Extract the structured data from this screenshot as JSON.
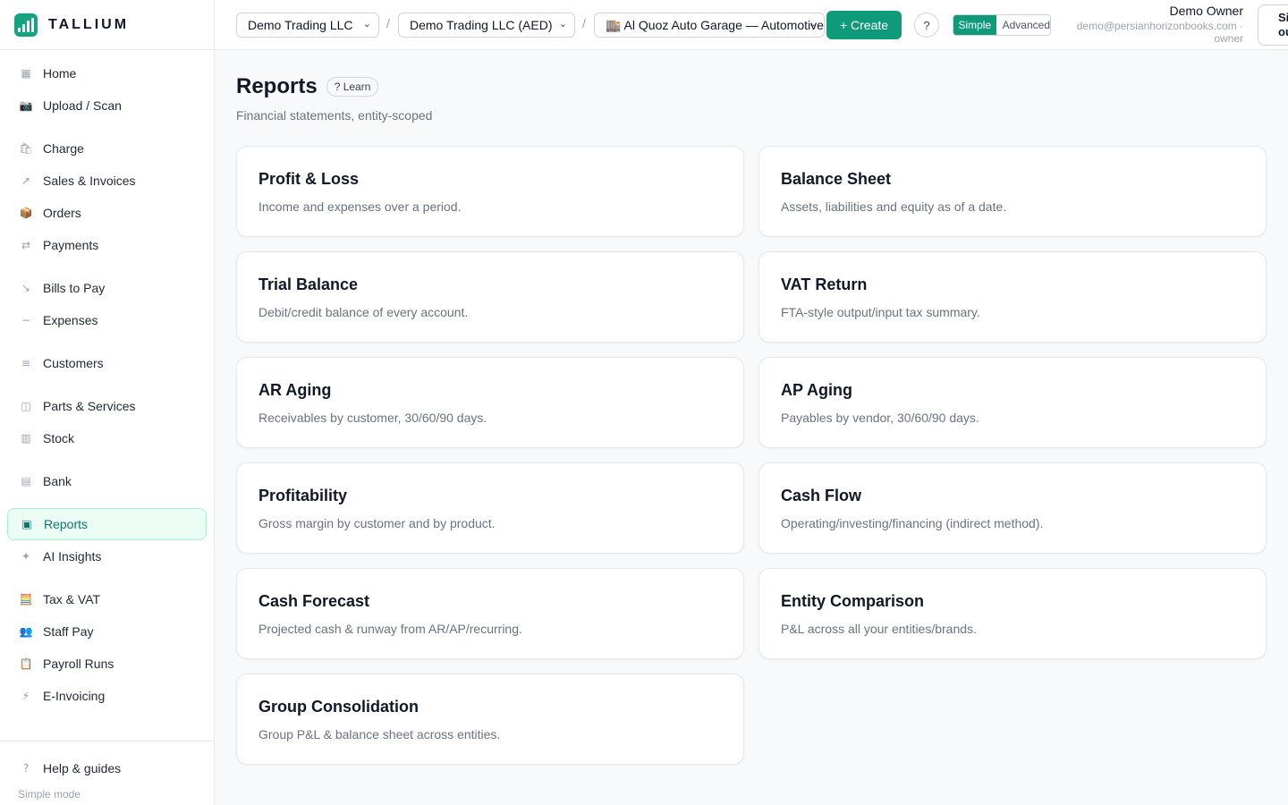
{
  "app": {
    "name": "TALLIUM"
  },
  "colors": {
    "accent": "#0f9b7a",
    "active_bg": "#ecfdf5"
  },
  "sidebar": {
    "items": [
      {
        "label": "Home",
        "icon": "grid-icon",
        "glyph": "▦"
      },
      {
        "label": "Upload / Scan",
        "icon": "camera-icon",
        "glyph": "📷"
      },
      {
        "label": "Charge",
        "icon": "shopping-bag-icon",
        "glyph": "🛍"
      },
      {
        "label": "Sales & Invoices",
        "icon": "arrow-up-right-icon",
        "glyph": "↗"
      },
      {
        "label": "Orders",
        "icon": "package-icon",
        "glyph": "📦"
      },
      {
        "label": "Payments",
        "icon": "arrows-swap-icon",
        "glyph": "⇄"
      },
      {
        "label": "Bills to Pay",
        "icon": "arrow-down-right-icon",
        "glyph": "↘"
      },
      {
        "label": "Expenses",
        "icon": "minus-icon",
        "glyph": "−"
      },
      {
        "label": "Customers",
        "icon": "list-icon",
        "glyph": "≡"
      },
      {
        "label": "Parts & Services",
        "icon": "box-icon",
        "glyph": "◫"
      },
      {
        "label": "Stock",
        "icon": "columns-icon",
        "glyph": "▥"
      },
      {
        "label": "Bank",
        "icon": "bank-icon",
        "glyph": "▤"
      },
      {
        "label": "Reports",
        "icon": "report-icon",
        "glyph": "▣",
        "active": true
      },
      {
        "label": "AI Insights",
        "icon": "sparkle-icon",
        "glyph": "✦"
      },
      {
        "label": "Tax & VAT",
        "icon": "abacus-icon",
        "glyph": "🧮"
      },
      {
        "label": "Staff Pay",
        "icon": "people-icon",
        "glyph": "👥"
      },
      {
        "label": "Payroll Runs",
        "icon": "clipboard-icon",
        "glyph": "📋"
      },
      {
        "label": "E-Invoicing",
        "icon": "lightning-icon",
        "glyph": "⚡"
      }
    ],
    "footer": {
      "help_label": "Help & guides",
      "help_glyph": "?",
      "mode_label": "Simple mode"
    }
  },
  "topbar": {
    "company_select": "Demo Trading LLC",
    "ledger_select": "Demo Trading LLC (AED)",
    "entity_select": "🏬 Al Quoz Auto Garage — Automotive",
    "separator": "/",
    "create_label": "+ Create",
    "help_label": "?",
    "mode_simple": "Simple",
    "mode_advanced": "Advanced",
    "user_name": "Demo Owner",
    "user_email": "demo@persianhorizonbooks.com ·",
    "user_role": "owner",
    "signout_label": "Sign out"
  },
  "main": {
    "title": "Reports",
    "learn_label": "? Learn",
    "subtitle": "Financial statements, entity-scoped",
    "cards": [
      {
        "title": "Profit & Loss",
        "desc": "Income and expenses over a period."
      },
      {
        "title": "Balance Sheet",
        "desc": "Assets, liabilities and equity as of a date."
      },
      {
        "title": "Trial Balance",
        "desc": "Debit/credit balance of every account."
      },
      {
        "title": "VAT Return",
        "desc": "FTA-style output/input tax summary."
      },
      {
        "title": "AR Aging",
        "desc": "Receivables by customer, 30/60/90 days."
      },
      {
        "title": "AP Aging",
        "desc": "Payables by vendor, 30/60/90 days."
      },
      {
        "title": "Profitability",
        "desc": "Gross margin by customer and by product."
      },
      {
        "title": "Cash Flow",
        "desc": "Operating/investing/financing (indirect method)."
      },
      {
        "title": "Cash Forecast",
        "desc": "Projected cash & runway from AR/AP/recurring."
      },
      {
        "title": "Entity Comparison",
        "desc": "P&L across all your entities/brands."
      },
      {
        "title": "Group Consolidation",
        "desc": "Group P&L & balance sheet across entities."
      }
    ]
  }
}
